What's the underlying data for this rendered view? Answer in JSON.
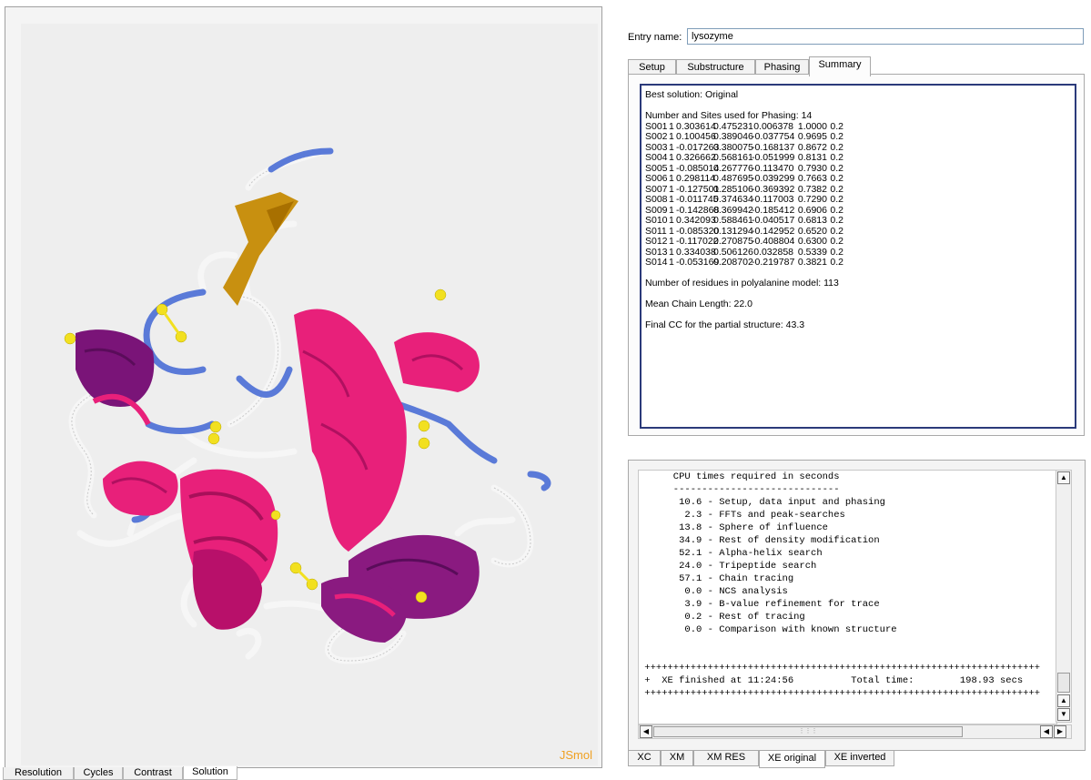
{
  "viewer": {
    "brand_label": "JSmol",
    "colors": {
      "helix": "#e8207a",
      "helix_dark": "#8a1a80",
      "strand": "#c89010",
      "turn": "#5878d8",
      "coil": "#f4f4f4",
      "ssbond": "#f2e020",
      "background": "#eeeeee"
    }
  },
  "left_tabs": [
    {
      "label": "Resolution",
      "active": false
    },
    {
      "label": "Cycles",
      "active": false
    },
    {
      "label": "Contrast",
      "active": false
    },
    {
      "label": "Solution",
      "active": true
    }
  ],
  "entry": {
    "label": "Entry name:",
    "value": "lysozyme"
  },
  "top_tabs": [
    {
      "label": "Setup",
      "active": false
    },
    {
      "label": "Substructure",
      "active": false
    },
    {
      "label": "Phasing",
      "active": false
    },
    {
      "label": "Summary",
      "active": true
    }
  ],
  "summary": {
    "best_solution": "Best solution: Original",
    "sites_header": "Number and Sites used for Phasing: 14",
    "sites": [
      [
        "S001",
        "1",
        "0.303614",
        "0.475231",
        "0.006378",
        "1.0000",
        "0.2"
      ],
      [
        "S002",
        "1",
        "0.100456",
        "0.389046",
        "-0.037754",
        "0.9695",
        "0.2"
      ],
      [
        "S003",
        "1",
        "-0.017263",
        "0.380075",
        "-0.168137",
        "0.8672",
        "0.2"
      ],
      [
        "S004",
        "1",
        "0.326662",
        "0.568161",
        "-0.051999",
        "0.8131",
        "0.2"
      ],
      [
        "S005",
        "1",
        "-0.085014",
        "0.267776",
        "-0.113470",
        "0.7930",
        "0.2"
      ],
      [
        "S006",
        "1",
        "0.298114",
        "0.487695",
        "-0.039299",
        "0.7663",
        "0.2"
      ],
      [
        "S007",
        "1",
        "-0.127501",
        "0.285106",
        "-0.369392",
        "0.7382",
        "0.2"
      ],
      [
        "S008",
        "1",
        "-0.011745",
        "0.374634",
        "-0.117003",
        "0.7290",
        "0.2"
      ],
      [
        "S009",
        "1",
        "-0.142868",
        "0.369942",
        "-0.185412",
        "0.6906",
        "0.2"
      ],
      [
        "S010",
        "1",
        "0.342093",
        "0.588461",
        "-0.040517",
        "0.6813",
        "0.2"
      ],
      [
        "S011",
        "1",
        "-0.085320",
        "0.131294",
        "-0.142952",
        "0.6520",
        "0.2"
      ],
      [
        "S012",
        "1",
        "-0.117022",
        "0.270875",
        "-0.408804",
        "0.6300",
        "0.2"
      ],
      [
        "S013",
        "1",
        "0.334038",
        "0.506126",
        "0.032858",
        "0.5339",
        "0.2"
      ],
      [
        "S014",
        "1",
        "-0.053169",
        "0.208702",
        "-0.219787",
        "0.3821",
        "0.2"
      ]
    ],
    "residues": "Number of residues in polyalanine model: 113",
    "chain_length": "Mean Chain Length: 22.0",
    "final_cc": "Final CC for the partial structure: 43.3"
  },
  "log": {
    "lines": [
      "      CPU times required in seconds",
      "      -----------------------------",
      "       10.6 - Setup, data input and phasing",
      "        2.3 - FFTs and peak-searches",
      "       13.8 - Sphere of influence",
      "       34.9 - Rest of density modification",
      "       52.1 - Alpha-helix search",
      "       24.0 - Tripeptide search",
      "       57.1 - Chain tracing",
      "        0.0 - NCS analysis",
      "        3.9 - B-value refinement for trace",
      "        0.2 - Rest of tracing",
      "        0.0 - Comparison with known structure",
      "",
      "",
      " +++++++++++++++++++++++++++++++++++++++++++++++++++++++++++++++++++++",
      " +  XE finished at 11:24:56          Total time:        198.93 secs",
      " +++++++++++++++++++++++++++++++++++++++++++++++++++++++++++++++++++++"
    ]
  },
  "log_tabs": [
    {
      "label": "XC",
      "active": false
    },
    {
      "label": "XM",
      "active": false
    },
    {
      "label": "XM RES",
      "active": false
    },
    {
      "label": "XE original",
      "active": true
    },
    {
      "label": "XE inverted",
      "active": false
    }
  ]
}
